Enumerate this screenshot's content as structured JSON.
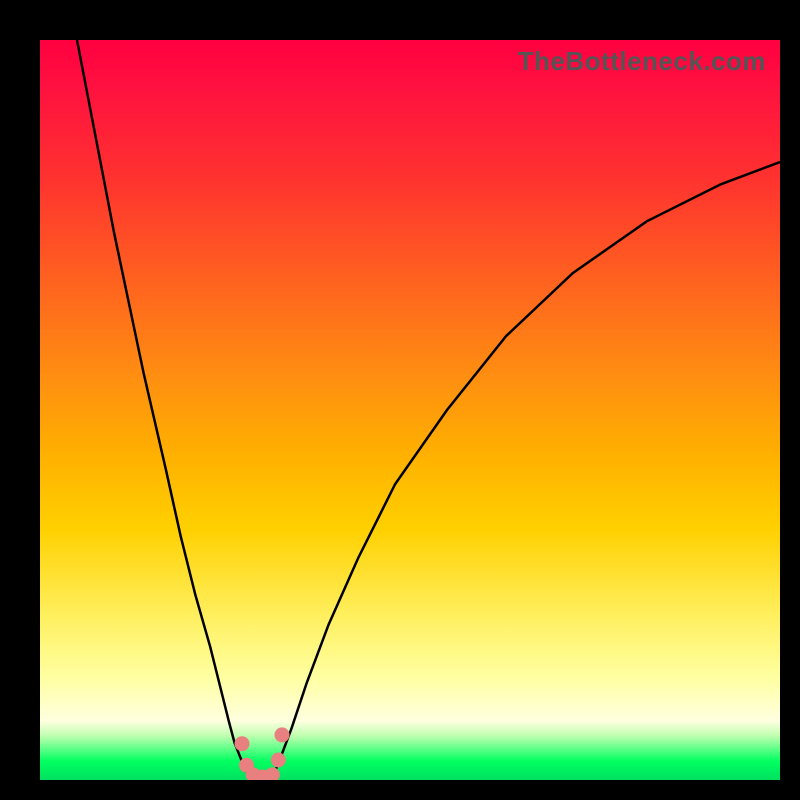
{
  "watermark": "TheBottleneck.com",
  "colors": {
    "bead_fill": "#E98080",
    "curve_stroke": "#000000",
    "gradient_top": "#ff0040",
    "gradient_bottom": "#00e060"
  },
  "chart_data": {
    "type": "line",
    "title": "",
    "xlabel": "",
    "ylabel": "",
    "xlim": [
      0,
      100
    ],
    "ylim": [
      0,
      100
    ],
    "background": "vertical-gradient-red-to-green",
    "series": [
      {
        "name": "left-curve",
        "x": [
          5,
          10,
          14,
          17,
          19,
          21,
          23,
          24.5,
          25.5,
          26.3,
          27.1,
          27.8,
          28.4
        ],
        "y": [
          100,
          74,
          55,
          42,
          33,
          25,
          18,
          12,
          8,
          5,
          3,
          1.2,
          0.5
        ]
      },
      {
        "name": "right-curve",
        "x": [
          31.5,
          32.5,
          34,
          36,
          39,
          43,
          48,
          55,
          63,
          72,
          82,
          92,
          100
        ],
        "y": [
          0.5,
          3,
          7,
          13,
          21,
          30,
          40,
          50,
          60,
          68.5,
          75.5,
          80.5,
          83.5
        ]
      },
      {
        "name": "trough-beads",
        "type": "scatter",
        "x": [
          27.3,
          27.9,
          28.8,
          30.1,
          31.4,
          32.2,
          32.7
        ],
        "y": [
          4.9,
          2.0,
          0.7,
          0.4,
          0.7,
          2.7,
          6.1
        ]
      }
    ]
  }
}
